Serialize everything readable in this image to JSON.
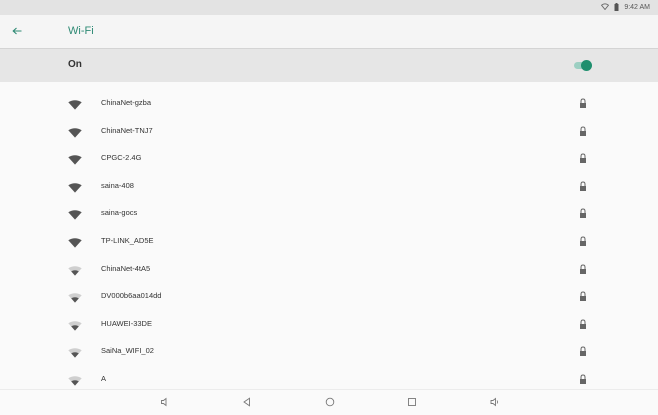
{
  "status_bar": {
    "time": "9:42 AM",
    "icons": [
      "wifi-status-icon",
      "battery-icon"
    ]
  },
  "header": {
    "title": "Wi-Fi",
    "back_icon": "arrow-back-icon"
  },
  "wifi_toggle": {
    "label": "On",
    "state": true,
    "accent_color": "#1f8f6e"
  },
  "networks": [
    {
      "ssid": "ChinaNet-gzba",
      "signal": "full",
      "secured": true
    },
    {
      "ssid": "ChinaNet-TNJ7",
      "signal": "full",
      "secured": true
    },
    {
      "ssid": "CPGC-2.4G",
      "signal": "full",
      "secured": true
    },
    {
      "ssid": "saina-408",
      "signal": "full",
      "secured": true
    },
    {
      "ssid": "saina-gocs",
      "signal": "full",
      "secured": true
    },
    {
      "ssid": "TP-LINK_AD5E",
      "signal": "full",
      "secured": true
    },
    {
      "ssid": "ChinaNet-4tA5",
      "signal": "partial",
      "secured": true
    },
    {
      "ssid": "DV000b6aa014dd",
      "signal": "partial",
      "secured": true
    },
    {
      "ssid": "HUAWEI-33DE",
      "signal": "partial",
      "secured": true
    },
    {
      "ssid": "SaiNa_WIFI_02",
      "signal": "partial",
      "secured": true
    },
    {
      "ssid": "A",
      "signal": "partial",
      "secured": true
    }
  ],
  "nav_bar": {
    "buttons": [
      "volume-down-icon",
      "back-triangle-icon",
      "home-circle-icon",
      "recents-square-icon",
      "volume-up-icon"
    ]
  }
}
